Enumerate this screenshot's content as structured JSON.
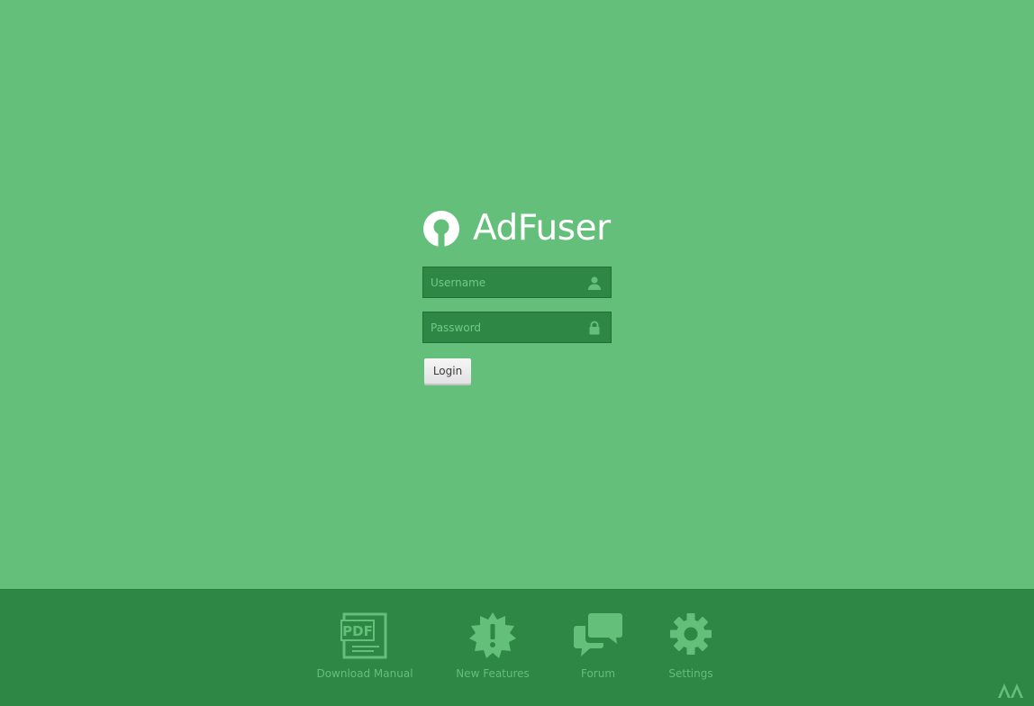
{
  "brand": {
    "name": "AdFuser",
    "logo_icon": "keyhole-circle-icon"
  },
  "login_form": {
    "username": {
      "value": "",
      "placeholder": "Username",
      "icon": "user-icon"
    },
    "password": {
      "value": "",
      "placeholder": "Password",
      "icon": "lock-icon"
    },
    "login_button_label": "Login"
  },
  "footer": {
    "items": [
      {
        "label": "Download Manual",
        "icon": "pdf-document-icon"
      },
      {
        "label": "New Features",
        "icon": "alert-badge-icon"
      },
      {
        "label": "Forum",
        "icon": "chat-bubbles-icon"
      },
      {
        "label": "Settings",
        "icon": "gear-icon"
      }
    ],
    "corner_logo": "vendor-logo-icon"
  },
  "colors": {
    "background": "#64bf7a",
    "footer_background": "#2e8744",
    "input_background": "#2e8744",
    "footer_icon": "#64bf7a",
    "brand_text": "#ffffff"
  }
}
